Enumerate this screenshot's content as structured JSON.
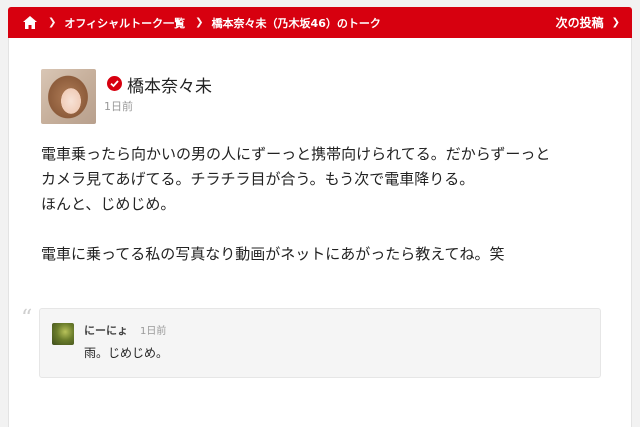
{
  "breadcrumb": {
    "items": [
      "オフィシャルトーク一覧",
      "橋本奈々未（乃木坂46）のトーク"
    ],
    "next_label": "次の投稿"
  },
  "post": {
    "author": "橋本奈々未",
    "time": "1日前",
    "lines": [
      "電車乗ったら向かいの男の人にずーっと携帯向けられてる。だからずーっと",
      "カメラ見てあげてる。チラチラ目が合う。もう次で電車降りる。",
      "ほんと、じめじめ。",
      "",
      "電車に乗ってる私の写真なり動画がネットにあがったら教えてね。笑"
    ]
  },
  "reply": {
    "user": "にーにょ",
    "time": "1日前",
    "text": "雨。じめじめ。"
  },
  "colors": {
    "accent": "#d7000f"
  }
}
